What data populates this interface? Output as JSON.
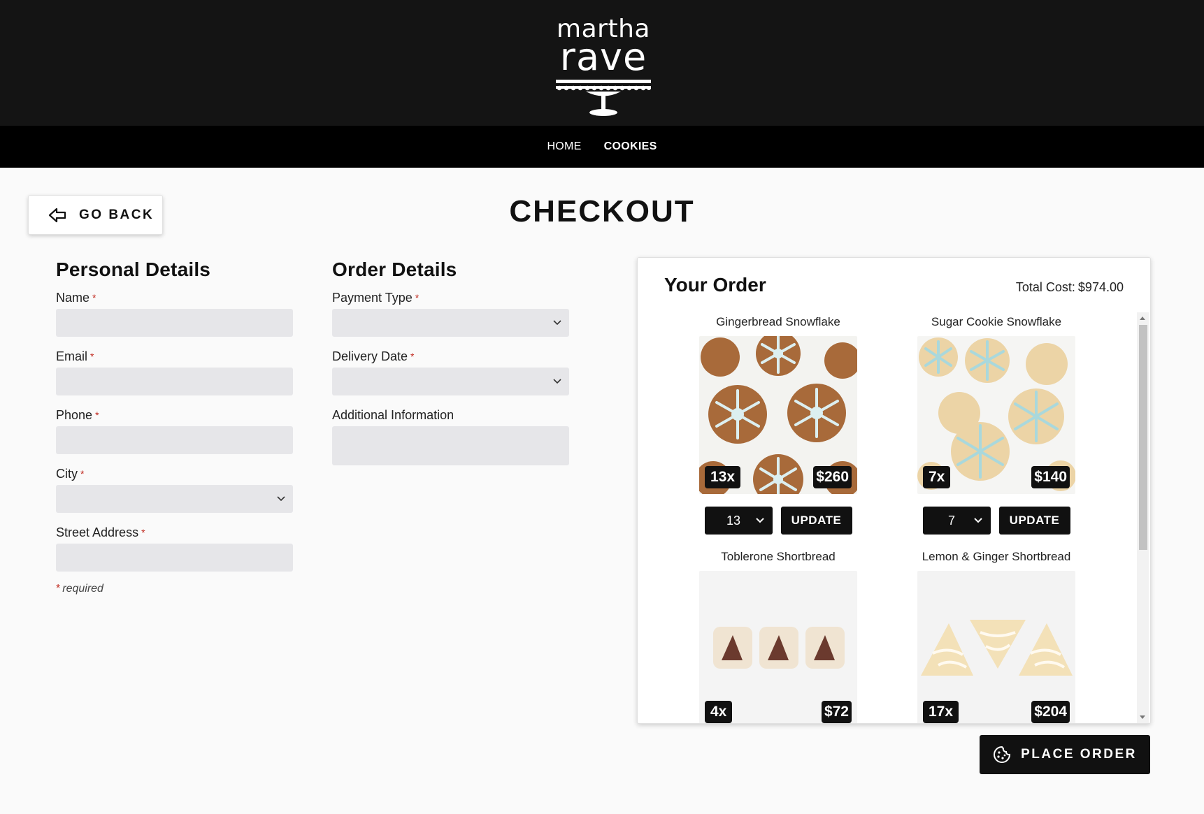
{
  "brand": {
    "line1": "martha",
    "line2": "rave"
  },
  "nav": [
    {
      "label": "HOME",
      "active": false
    },
    {
      "label": "COOKIES",
      "active": true
    }
  ],
  "go_back_label": "GO BACK",
  "page_title": "CHECKOUT",
  "personal": {
    "heading": "Personal Details",
    "fields": [
      {
        "label": "Name",
        "required": true,
        "type": "text",
        "value": ""
      },
      {
        "label": "Email",
        "required": true,
        "type": "text",
        "value": ""
      },
      {
        "label": "Phone",
        "required": true,
        "type": "text",
        "value": ""
      },
      {
        "label": "City",
        "required": true,
        "type": "select",
        "value": ""
      },
      {
        "label": "Street Address",
        "required": true,
        "type": "text",
        "value": ""
      }
    ],
    "required_note": "required"
  },
  "order_details": {
    "heading": "Order Details",
    "fields": [
      {
        "label": "Payment Type",
        "required": true,
        "type": "select",
        "value": ""
      },
      {
        "label": "Delivery Date",
        "required": true,
        "type": "select",
        "value": ""
      },
      {
        "label": "Additional Information",
        "required": false,
        "type": "textarea",
        "value": ""
      }
    ]
  },
  "your_order": {
    "heading": "Your Order",
    "total_label": "Total Cost:",
    "total_value": "$974.00",
    "items": [
      {
        "name": "Gingerbread Snowflake",
        "qty_badge": "13x",
        "price": "$260",
        "qty_value": "13",
        "update_label": "UPDATE",
        "image": "gingerbread-snowflake-cookies"
      },
      {
        "name": "Sugar Cookie Snowflake",
        "qty_badge": "7x",
        "price": "$140",
        "qty_value": "7",
        "update_label": "UPDATE",
        "image": "sugar-cookie-snowflakes"
      },
      {
        "name": "Toblerone Shortbread",
        "qty_badge": "4x",
        "price": "$72",
        "image": "toblerone-shortbread"
      },
      {
        "name": "Lemon & Ginger Shortbread",
        "qty_badge": "17x",
        "price": "$204",
        "image": "lemon-ginger-shortbread"
      }
    ]
  },
  "place_order_label": "PLACE ORDER",
  "colors": {
    "header": "#141414",
    "nav": "#000000",
    "required": "#c0281e",
    "field": "#e6e6e9",
    "button": "#111111"
  },
  "icons": [
    "back-arrow-icon",
    "chevron-down-icon",
    "cookie-icon",
    "cake-stand-icon"
  ]
}
